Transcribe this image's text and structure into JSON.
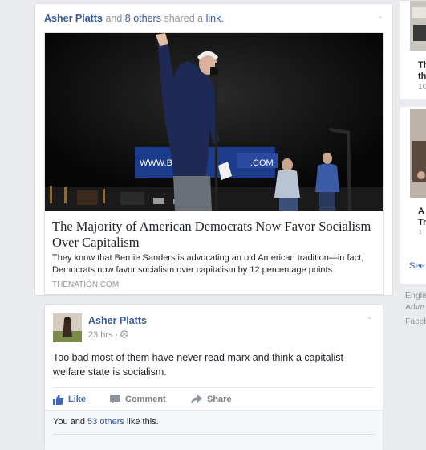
{
  "story": {
    "actor": "Asher Platts",
    "conj": "and",
    "others": "8 others",
    "verb": "shared a",
    "object": "link.",
    "link_title": "The Majority of American Democrats Now Favor Socialism Over Capitalism",
    "link_desc": "They know that Bernie Sanders is advocating an old American tradition—in fact, Democrats now favor socialism over capitalism by 12 percentage points.",
    "link_domain": "THENATION.COM",
    "banner_left": "WWW.BE",
    "banner_right": ".COM"
  },
  "post": {
    "author": "Asher Platts",
    "time": "23 hrs · ",
    "text": "Too bad most of them have never read marx and think a capitalist welfare state is socialism.",
    "actions": {
      "like": "Like",
      "comment": "Comment",
      "share": "Share"
    },
    "likes_prefix": "You and ",
    "likes_others": "53 others",
    "likes_suffix": " like this."
  },
  "sidebar": {
    "card1_title_1": "Th",
    "card1_title_2": "th",
    "card1_meta": "10",
    "card2_title_1": "A",
    "card2_title_2": "Tr",
    "card2_meta": "1",
    "see_more": "See",
    "footer_1": "Englis",
    "footer_2": "Adve",
    "footer_3": "Faceb"
  },
  "colors": {
    "link": "#365899",
    "like_active": "#4267b2",
    "background": "#e9ebee"
  },
  "icons": [
    "chevron-down-icon",
    "globe-icon",
    "like-icon",
    "comment-icon",
    "share-icon"
  ]
}
